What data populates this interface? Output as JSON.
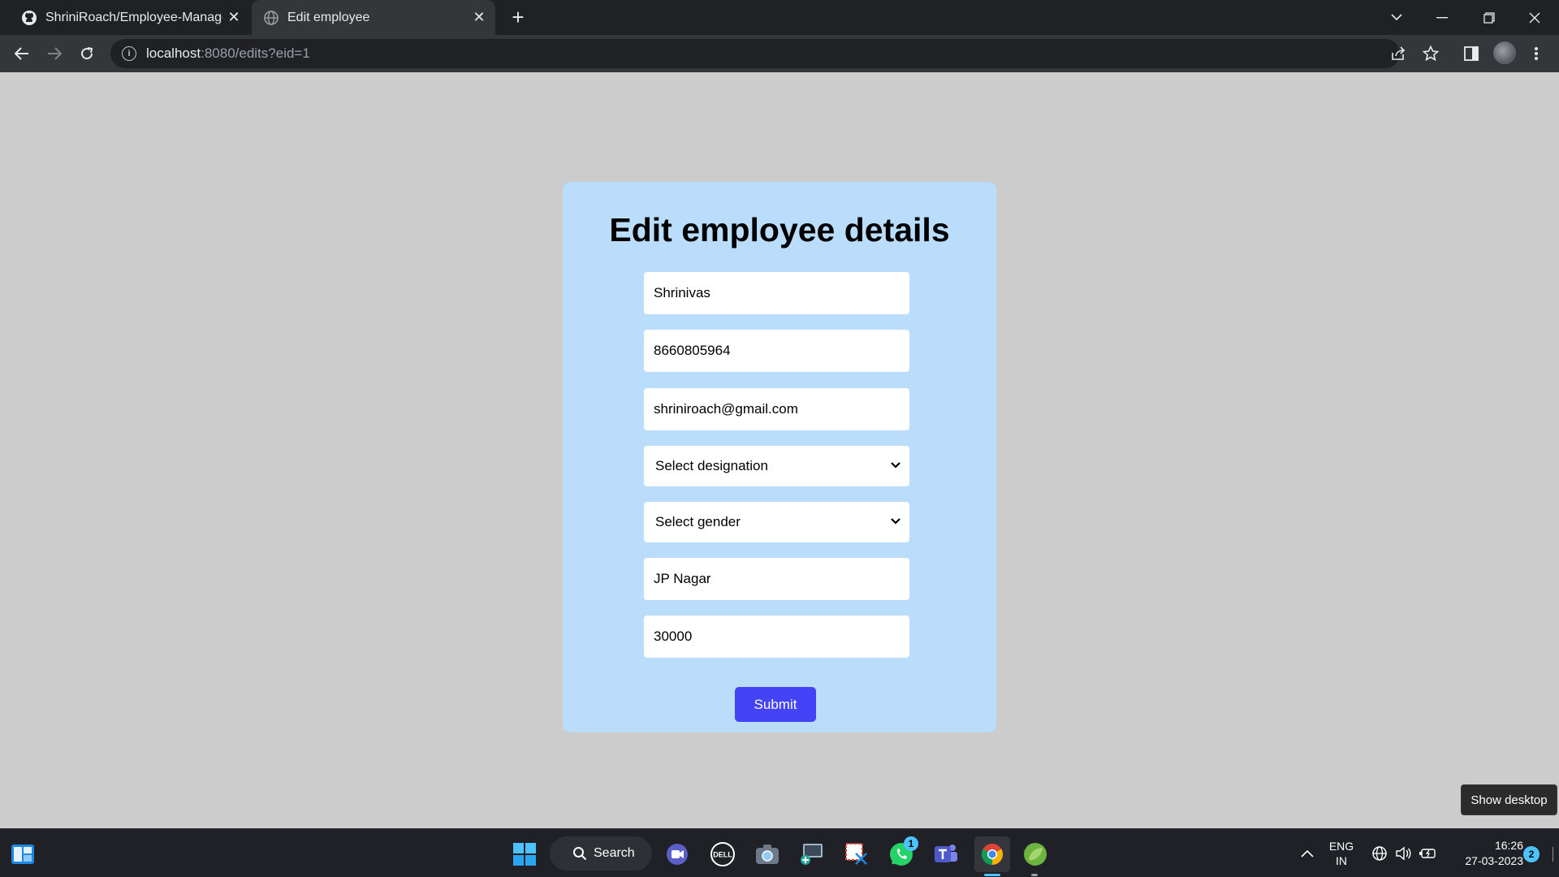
{
  "browser": {
    "tabs": [
      {
        "title": "ShriniRoach/Employee-Managem",
        "close": "✕"
      },
      {
        "title": "Edit employee",
        "close": "✕"
      }
    ],
    "new_tab": "+",
    "url_host": "localhost",
    "url_path": ":8080/edits?eid=1"
  },
  "form": {
    "heading": "Edit employee details",
    "name": "Shrinivas",
    "phone": "8660805964",
    "email": "shriniroach@gmail.com",
    "designation_selected": "Select designation",
    "gender_selected": "Select gender",
    "address": "JP Nagar",
    "salary": "30000",
    "submit_label": "Submit"
  },
  "tooltip": "Show desktop",
  "taskbar": {
    "search_label": "Search",
    "whatsapp_badge": "1",
    "language_top": "ENG",
    "language_bottom": "IN",
    "time": "16:26",
    "date": "27-03-2023",
    "notification_count": "2"
  },
  "colors": {
    "page_bg": "#cccccc",
    "card_bg": "#b9ddfb",
    "submit_bg": "#4543f7"
  }
}
